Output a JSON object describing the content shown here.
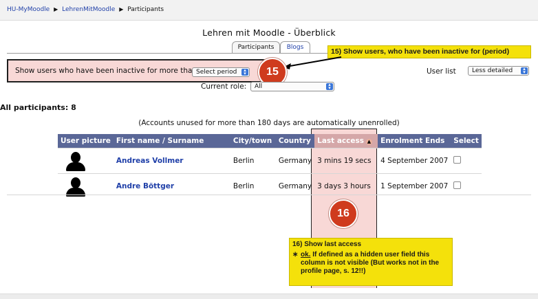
{
  "breadcrumb": {
    "items": [
      "HU-MyMoodle",
      "LehrenMitMoodle",
      "Participants"
    ],
    "separator": "▶"
  },
  "page_title": "Lehren mit Moodle - Überblick",
  "tabs": [
    {
      "label": "Participants",
      "active": true
    },
    {
      "label": "Blogs",
      "active": false
    }
  ],
  "inactive_filter": {
    "label": "Show users who have been inactive for more than",
    "select_value": "Select period"
  },
  "user_list": {
    "label": "User list",
    "select_value": "Less detailed"
  },
  "current_role": {
    "label": "Current role:",
    "select_value": "All"
  },
  "all_participants": "All participants: 8",
  "unused_note": "(Accounts unused for more than 180 days are automatically unenrolled)",
  "table": {
    "headers": {
      "picture": "User picture",
      "firstname": "First name",
      "slash": " / ",
      "surname": "Surname",
      "city": "City/town",
      "country": "Country",
      "last_access": "Last access",
      "enrolment_ends": "Enrolment Ends",
      "select": "Select"
    },
    "rows": [
      {
        "name": "Andreas Vollmer",
        "city": "Berlin",
        "country": "Germany",
        "last_access": "3 mins 19 secs",
        "enrolment_ends": "4 September 2007"
      },
      {
        "name": "Andre Böttger",
        "city": "Berlin",
        "country": "Germany",
        "last_access": "3 days 3 hours",
        "enrolment_ends": "1 September 2007"
      }
    ]
  },
  "annotations": {
    "badge15": "15",
    "callout15": "15) Show users, who have been inactive for (period)",
    "badge16": "16",
    "callout16_title": "16) Show last access",
    "callout16_ok": "ok.",
    "callout16_text": " If defined as a hidden user field this column is not visible (But works not in the profile page, s. 12!!)",
    "star": "∗"
  },
  "colors": {
    "header_bg": "#5a6797",
    "link": "#1f3fa8",
    "highlight": "#f8d8d6",
    "callout": "#f4e10b",
    "badge": "#cf3b1e"
  }
}
